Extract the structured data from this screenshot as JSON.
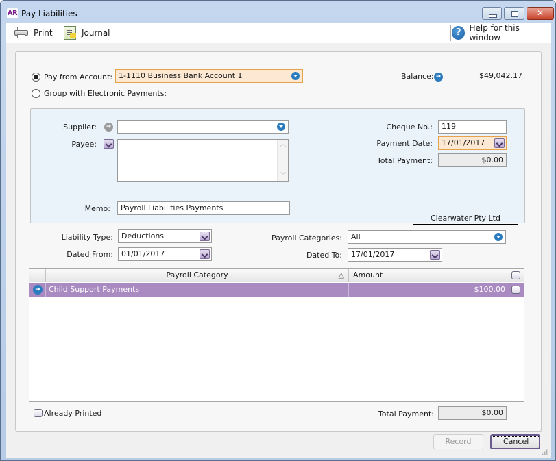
{
  "window": {
    "app_badge": "AR",
    "title": "Pay Liabilities",
    "controls": {
      "close_glyph": "✕"
    }
  },
  "toolbar": {
    "print_label": "Print",
    "journal_label": "Journal",
    "help_label": "Help for this window",
    "help_glyph": "?"
  },
  "account": {
    "pay_from_label": "Pay from Account:",
    "pay_from_value": "1-1110 Business Bank Account 1",
    "pay_from_selected": true,
    "group_label": "Group with Electronic Payments:",
    "balance_label": "Balance:",
    "balance_value": "$49,042.17"
  },
  "payment": {
    "supplier_label": "Supplier:",
    "supplier_value": "",
    "payee_label": "Payee:",
    "payee_value": "",
    "memo_label": "Memo:",
    "memo_value": "Payroll Liabilities Payments",
    "cheque_label": "Cheque No.:",
    "cheque_value": "119",
    "date_label": "Payment Date:",
    "date_value": "17/01/2017",
    "total_label": "Total Payment:",
    "total_value": "$0.00",
    "company_name": "Clearwater Pty Ltd"
  },
  "filters": {
    "liability_type_label": "Liability Type:",
    "liability_type_value": "Deductions",
    "dated_from_label": "Dated From:",
    "dated_from_value": "01/01/2017",
    "payroll_categories_label": "Payroll Categories:",
    "payroll_categories_value": "All",
    "dated_to_label": "Dated To:",
    "dated_to_value": "17/01/2017"
  },
  "grid": {
    "columns": [
      "Payroll Category",
      "Amount"
    ],
    "sort_glyph": "△",
    "rows": [
      {
        "category": "Child Support Payments",
        "amount": "$100.00",
        "selected": true
      }
    ]
  },
  "footer": {
    "already_printed_label": "Already Printed",
    "total_label": "Total Payment:",
    "total_value": "$0.00",
    "record_label": "Record",
    "cancel_label": "Cancel"
  }
}
